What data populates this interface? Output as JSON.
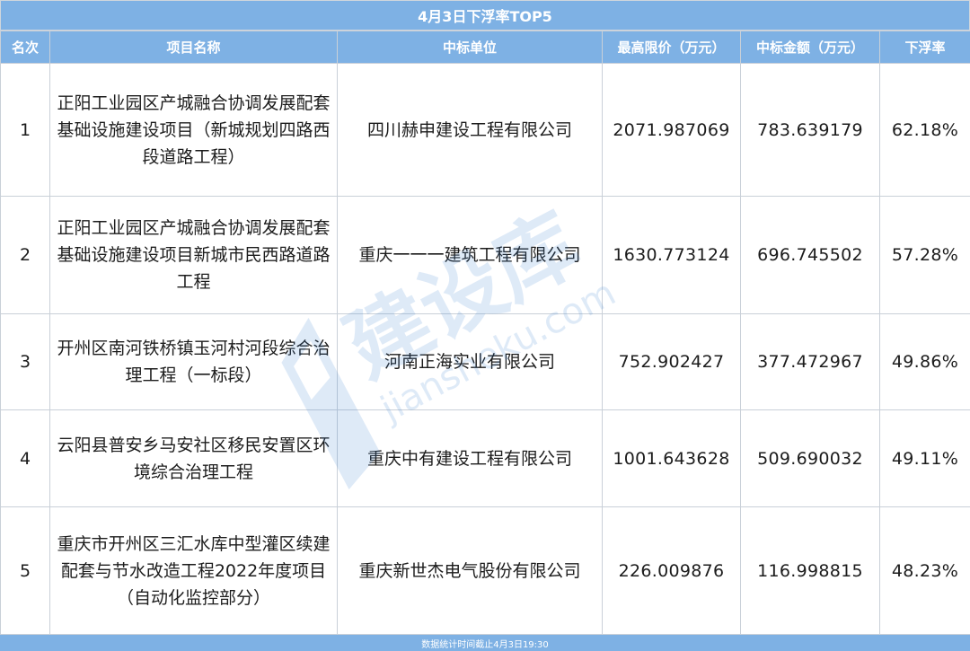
{
  "title": "4月3日下浮率TOP5",
  "headers": [
    "名次",
    "项目名称",
    "中标单位",
    "最高限价（万元）",
    "中标金额（万元）",
    "下浮率"
  ],
  "rows": [
    {
      "rank": "1",
      "project": "正阳工业园区产城融合协调发展配套基础设施建设项目（新城规划四路西段道路工程）",
      "company": "四川赫申建设工程有限公司",
      "max_price": "2071.987069",
      "bid_amount": "783.639179",
      "rate": "62.18%"
    },
    {
      "rank": "2",
      "project": "正阳工业园区产城融合协调发展配套基础设施建设项目新城市民西路道路工程",
      "company": "重庆一一一建筑工程有限公司",
      "max_price": "1630.773124",
      "bid_amount": "696.745502",
      "rate": "57.28%"
    },
    {
      "rank": "3",
      "project": "开州区南河铁桥镇玉河村河段综合治理工程（一标段）",
      "company": "河南正海实业有限公司",
      "max_price": "752.902427",
      "bid_amount": "377.472967",
      "rate": "49.86%"
    },
    {
      "rank": "4",
      "project": "云阳县普安乡马安社区移民安置区环境综合治理工程",
      "company": "重庆中有建设工程有限公司",
      "max_price": "1001.643628",
      "bid_amount": "509.690032",
      "rate": "49.11%"
    },
    {
      "rank": "5",
      "project": "重庆市开州区三汇水库中型灌区续建配套与节水改造工程2022年度项目（自动化监控部分）",
      "company": "重庆新世杰电气股份有限公司",
      "max_price": "226.009876",
      "bid_amount": "116.998815",
      "rate": "48.23%"
    }
  ],
  "footer": "数据统计时间截止4月3日19:30",
  "watermark": {
    "cn": "建设库",
    "en": "jianshеku.com"
  },
  "colors": {
    "header_bg": "#7eb1e4",
    "header_text": "#ffffff",
    "border": "#c9d0d8",
    "watermark": "#3a7fd0"
  }
}
